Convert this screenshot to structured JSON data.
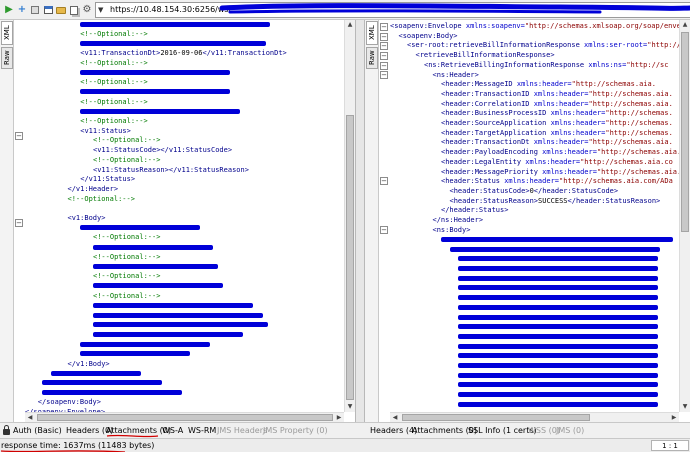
{
  "toolbar": {
    "icons": [
      "play-icon",
      "add-icon",
      "stop-icon",
      "window-icon",
      "folder-icon",
      "copy-icon",
      "settings-icon"
    ],
    "endpoint_url": "https://10.48.154.30:6256/ws/"
  },
  "left_pane": {
    "tabs": [
      "XML",
      "Raw"
    ],
    "lines": [
      {
        "indent": 13,
        "redact": 190
      },
      {
        "indent": 13,
        "parts": [
          [
            "c",
            "<!--Optional:-->"
          ]
        ]
      },
      {
        "indent": 13,
        "redact": 186
      },
      {
        "indent": 13,
        "parts": [
          [
            "t",
            "<v11:TransactionDt>"
          ],
          [
            "x",
            "2016-09-06"
          ],
          [
            "t",
            "</v11:TransactionDt>"
          ]
        ]
      },
      {
        "indent": 13,
        "parts": [
          [
            "c",
            "<!--Optional:-->"
          ]
        ]
      },
      {
        "indent": 13,
        "redact": 150
      },
      {
        "indent": 13,
        "parts": [
          [
            "c",
            "<!--Optional:-->"
          ]
        ]
      },
      {
        "indent": 13,
        "redact": 150
      },
      {
        "indent": 13,
        "parts": [
          [
            "c",
            "<!--Optional:-->"
          ]
        ]
      },
      {
        "indent": 13,
        "redact": 160
      },
      {
        "indent": 13,
        "parts": [
          [
            "c",
            "<!--Optional:-->"
          ]
        ]
      },
      {
        "indent": 13,
        "parts": [
          [
            "t",
            "<v11:Status>"
          ]
        ]
      },
      {
        "indent": 16,
        "parts": [
          [
            "c",
            "<!--Optional:-->"
          ]
        ]
      },
      {
        "indent": 16,
        "parts": [
          [
            "t",
            "<v11:StatusCode></v11:StatusCode>"
          ]
        ]
      },
      {
        "indent": 16,
        "parts": [
          [
            "c",
            "<!--Optional:-->"
          ]
        ]
      },
      {
        "indent": 16,
        "parts": [
          [
            "t",
            "<v11:StatusReason></v11:StatusReason>"
          ]
        ]
      },
      {
        "indent": 13,
        "parts": [
          [
            "t",
            "</v11:Status>"
          ]
        ]
      },
      {
        "indent": 10,
        "parts": [
          [
            "t",
            "</v1:Header>"
          ]
        ]
      },
      {
        "indent": 10,
        "parts": [
          [
            "c",
            "<!--Optional:-->"
          ]
        ]
      },
      {
        "indent": 0,
        "parts": []
      },
      {
        "indent": 10,
        "parts": [
          [
            "t",
            "<v1:Body>"
          ]
        ]
      },
      {
        "indent": 13,
        "redact": 120
      },
      {
        "indent": 16,
        "parts": [
          [
            "c",
            "<!--Optional:-->"
          ]
        ]
      },
      {
        "indent": 16,
        "redact": 120
      },
      {
        "indent": 16,
        "parts": [
          [
            "c",
            "<!--Optional:-->"
          ]
        ]
      },
      {
        "indent": 16,
        "redact": 125
      },
      {
        "indent": 16,
        "parts": [
          [
            "c",
            "<!--Optional:-->"
          ]
        ]
      },
      {
        "indent": 16,
        "redact": 130
      },
      {
        "indent": 16,
        "parts": [
          [
            "c",
            "<!--Optional:-->"
          ]
        ]
      },
      {
        "indent": 16,
        "redact": 160
      },
      {
        "indent": 16,
        "redact": 170
      },
      {
        "indent": 16,
        "redact": 175
      },
      {
        "indent": 16,
        "redact": 150
      },
      {
        "indent": 13,
        "redact": 130
      },
      {
        "indent": 13,
        "redact": 110
      },
      {
        "indent": 10,
        "parts": [
          [
            "t",
            "</v1:Body>"
          ]
        ]
      },
      {
        "indent": 6,
        "redact": 90
      },
      {
        "indent": 4,
        "redact": 120
      },
      {
        "indent": 4,
        "redact": 140
      },
      {
        "indent": 3,
        "parts": [
          [
            "t",
            "</soapenv:Body>"
          ]
        ]
      },
      {
        "indent": 0,
        "parts": [
          [
            "t",
            "</soapenv:Envelope>"
          ]
        ]
      }
    ]
  },
  "right_pane": {
    "tabs": [
      "XML",
      "Raw"
    ],
    "lines": [
      {
        "indent": 0,
        "parts": [
          [
            "t",
            "<soapenv:Envelope "
          ],
          [
            "a",
            "xmlns:soapenv="
          ],
          [
            "v",
            "\"http://schemas.xmlsoap.org/soap/envelope/\""
          ]
        ]
      },
      {
        "indent": 2,
        "parts": [
          [
            "t",
            "<soapenv:Body>"
          ]
        ]
      },
      {
        "indent": 4,
        "parts": [
          [
            "t",
            "<ser-root:retrieveBillInformationResponse "
          ],
          [
            "a",
            "xmlns:ser-root="
          ],
          [
            "v",
            "\"http://ex"
          ]
        ]
      },
      {
        "indent": 6,
        "parts": [
          [
            "t",
            "<retrieveBillInformationResponse>"
          ]
        ]
      },
      {
        "indent": 8,
        "parts": [
          [
            "t",
            "<ns:RetrieveBillingInformationResponse "
          ],
          [
            "a",
            "xmlns:ns="
          ],
          [
            "v",
            "\"http://sc"
          ]
        ]
      },
      {
        "indent": 10,
        "parts": [
          [
            "t",
            "<ns:Header>"
          ]
        ]
      },
      {
        "indent": 12,
        "parts": [
          [
            "t",
            "<header:MessageID "
          ],
          [
            "a",
            "xmlns:header="
          ],
          [
            "v",
            "\"http://schemas.aia."
          ]
        ]
      },
      {
        "indent": 12,
        "parts": [
          [
            "t",
            "<header:TransactionID "
          ],
          [
            "a",
            "xmlns:header="
          ],
          [
            "v",
            "\"http://schemas.aia."
          ]
        ]
      },
      {
        "indent": 12,
        "parts": [
          [
            "t",
            "<header:CorrelationID "
          ],
          [
            "a",
            "xmlns:header="
          ],
          [
            "v",
            "\"http://schemas.aia."
          ]
        ]
      },
      {
        "indent": 12,
        "parts": [
          [
            "t",
            "<header:BusinessProcessID "
          ],
          [
            "a",
            "xmlns:header="
          ],
          [
            "v",
            "\"http://schemas."
          ]
        ]
      },
      {
        "indent": 12,
        "parts": [
          [
            "t",
            "<header:SourceApplication "
          ],
          [
            "a",
            "xmlns:header="
          ],
          [
            "v",
            "\"http://schemas."
          ]
        ]
      },
      {
        "indent": 12,
        "parts": [
          [
            "t",
            "<header:TargetApplication "
          ],
          [
            "a",
            "xmlns:header="
          ],
          [
            "v",
            "\"http://schemas."
          ]
        ]
      },
      {
        "indent": 12,
        "parts": [
          [
            "t",
            "<header:TransactionDt "
          ],
          [
            "a",
            "xmlns:header="
          ],
          [
            "v",
            "\"http://schemas.aia."
          ]
        ]
      },
      {
        "indent": 12,
        "parts": [
          [
            "t",
            "<header:PayloadEncoding "
          ],
          [
            "a",
            "xmlns:header="
          ],
          [
            "v",
            "\"http://schemas.aia."
          ]
        ]
      },
      {
        "indent": 12,
        "parts": [
          [
            "t",
            "<header:LegalEntity "
          ],
          [
            "a",
            "xmlns:header="
          ],
          [
            "v",
            "\"http://schemas.aia.co"
          ]
        ]
      },
      {
        "indent": 12,
        "parts": [
          [
            "t",
            "<header:MessagePriority "
          ],
          [
            "a",
            "xmlns:header="
          ],
          [
            "v",
            "\"http://schemas.aia."
          ]
        ]
      },
      {
        "indent": 12,
        "parts": [
          [
            "t",
            "<header:Status "
          ],
          [
            "a",
            "xmlns:header="
          ],
          [
            "v",
            "\"http://schemas.aia.com/ADa"
          ]
        ]
      },
      {
        "indent": 14,
        "parts": [
          [
            "t",
            "<header:StatusCode>"
          ],
          [
            "x",
            "0"
          ],
          [
            "t",
            "</header:StatusCode>"
          ]
        ]
      },
      {
        "indent": 14,
        "parts": [
          [
            "t",
            "<header:StatusReason>"
          ],
          [
            "x",
            "SUCCESS"
          ],
          [
            "t",
            "</header:StatusReason>"
          ]
        ]
      },
      {
        "indent": 12,
        "parts": [
          [
            "t",
            "</header:Status>"
          ]
        ]
      },
      {
        "indent": 10,
        "parts": [
          [
            "t",
            "</ns:Header>"
          ]
        ]
      },
      {
        "indent": 10,
        "parts": [
          [
            "t",
            "<ns:Body>"
          ]
        ]
      },
      {
        "indent": 12,
        "redact": 232
      },
      {
        "indent": 14,
        "redact": 210
      },
      {
        "indent": 16,
        "redact": 200
      },
      {
        "indent": 16,
        "redact": 200
      },
      {
        "indent": 16,
        "redact": 200
      },
      {
        "indent": 16,
        "redact": 200
      },
      {
        "indent": 16,
        "redact": 200
      },
      {
        "indent": 16,
        "redact": 200
      },
      {
        "indent": 16,
        "redact": 200
      },
      {
        "indent": 16,
        "redact": 200
      },
      {
        "indent": 16,
        "redact": 200
      },
      {
        "indent": 16,
        "redact": 200
      },
      {
        "indent": 16,
        "redact": 200
      },
      {
        "indent": 16,
        "redact": 200
      },
      {
        "indent": 16,
        "redact": 200
      },
      {
        "indent": 16,
        "redact": 200
      },
      {
        "indent": 16,
        "redact": 200
      },
      {
        "indent": 16,
        "redact": 200
      }
    ]
  },
  "request_tabs": [
    {
      "label": "Auth (Basic)",
      "enabled": true
    },
    {
      "label": "Headers (0)",
      "enabled": true
    },
    {
      "label": "Attachments (0)",
      "enabled": true
    },
    {
      "label": "WS-A",
      "enabled": true
    },
    {
      "label": "WS-RM",
      "enabled": true
    },
    {
      "label": "JMS Headers",
      "enabled": false
    },
    {
      "label": "JMS Property (0)",
      "enabled": false
    }
  ],
  "response_tabs": [
    {
      "label": "Headers (4)",
      "enabled": true
    },
    {
      "label": "Attachments (0)",
      "enabled": true
    },
    {
      "label": "SSL Info (1 certs)",
      "enabled": true
    },
    {
      "label": "WSS (0)",
      "enabled": false
    },
    {
      "label": "JMS (0)",
      "enabled": false
    }
  ],
  "status": {
    "response_time": "response time: 1637ms (11483 bytes)",
    "cursor_position": "1 : 1"
  },
  "colors": {
    "tag": "#00008b",
    "comment": "#007a00",
    "attribute": "#0000cd",
    "value": "#8b0000",
    "redaction": "#0000d8"
  }
}
